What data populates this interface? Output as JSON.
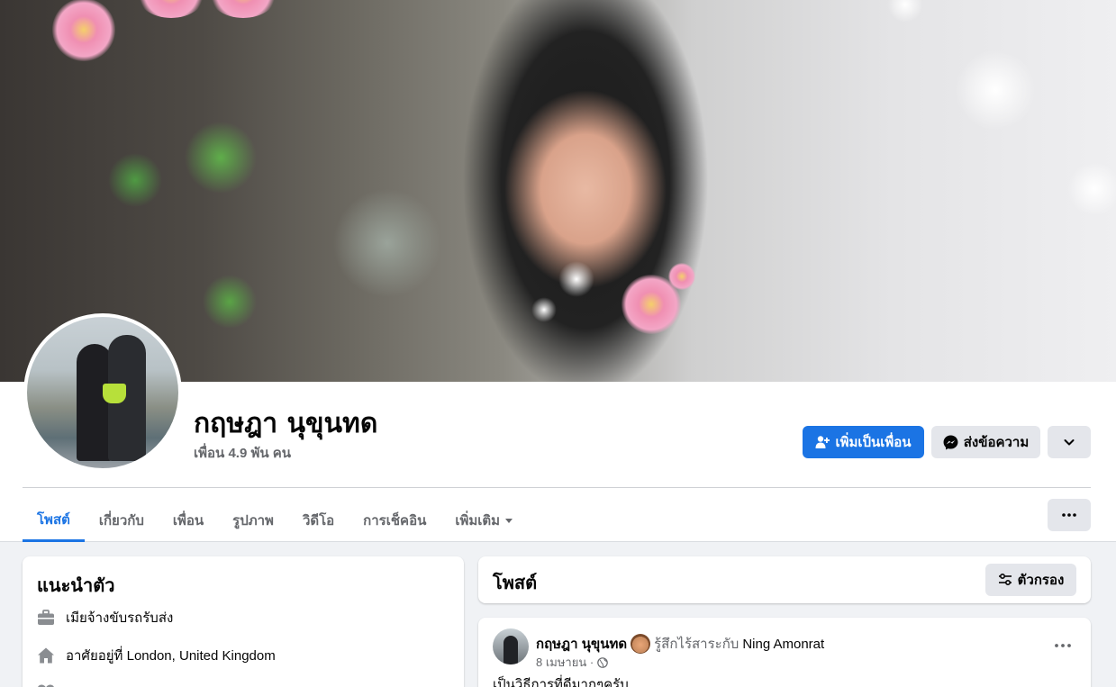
{
  "profile": {
    "name": "กฤษฎา นุขุนทด",
    "friends_count": "เพื่อน 4.9 พัน คน"
  },
  "actions": {
    "add_friend": "เพิ่มเป็นเพื่อน",
    "message": "ส่งข้อความ"
  },
  "tabs": [
    {
      "label": "โพสต์",
      "active": true
    },
    {
      "label": "เกี่ยวกับ"
    },
    {
      "label": "เพื่อน"
    },
    {
      "label": "รูปภาพ"
    },
    {
      "label": "วิดีโอ"
    },
    {
      "label": "การเช็คอิน"
    },
    {
      "label": "เพิ่มเติม"
    }
  ],
  "intro": {
    "title": "แนะนำตัว",
    "work": "เมียจ้างขับรถรับส่ง",
    "lives": "อาศัยอยู่ที่ London, United Kingdom"
  },
  "posts": {
    "title": "โพสต์",
    "filter_label": "ตัวกรอง"
  },
  "post": {
    "author": "กฤษฎา นุขุนทด",
    "feeling": "รู้สึกไร้สาระกับ",
    "tagged": "Ning Amonrat",
    "date": "8 เมษายน ·",
    "text": "เป็นวิธีการที่ดีมากๆครับ"
  },
  "colors": {
    "accent": "#1b74e4",
    "secondary_button": "#e4e6eb",
    "muted_text": "#65676b",
    "page_bg": "#f0f2f5"
  }
}
